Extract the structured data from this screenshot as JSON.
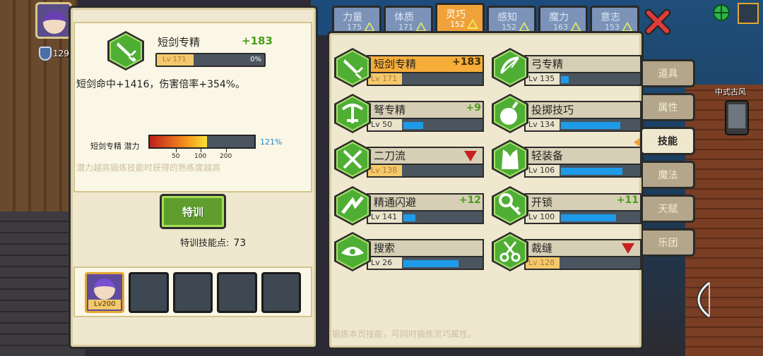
{
  "player": {
    "level": "129",
    "avatar_level": "Lv200"
  },
  "detail": {
    "name": "短剑专精",
    "bonus": "+183",
    "level": "Lv 171",
    "progress_percent": "0%",
    "description": "短剑命中+1416，伤害倍率+354%。",
    "potential_label": "短剑专精 潜力",
    "potential_value": "121%",
    "potential_fill": 0.55,
    "ticks": [
      "50",
      "100",
      "200"
    ],
    "potential_note": "潜力越高锻炼技能时获得的熟练度越高"
  },
  "training": {
    "button_label": "特训",
    "points_label": "特训技能点:",
    "points_value": "73"
  },
  "tabs": [
    {
      "name": "力量",
      "value": "175"
    },
    {
      "name": "体质",
      "value": "171"
    },
    {
      "name": "灵巧",
      "value": "152"
    },
    {
      "name": "感知",
      "value": "152"
    },
    {
      "name": "魔力",
      "value": "163"
    },
    {
      "name": "意志",
      "value": "153"
    }
  ],
  "skills": [
    {
      "name": "短剑专精",
      "bonus": "+183",
      "level": "Lv 171",
      "fill": 0.0,
      "icon": "dagger-icon"
    },
    {
      "name": "弓专精",
      "bonus": "",
      "level": "Lv 135",
      "fill": 0.1,
      "icon": "bow-icon"
    },
    {
      "name": "弩专精",
      "bonus": "+9",
      "level": "Lv 50",
      "fill": 0.25,
      "icon": "crossbow-icon"
    },
    {
      "name": "投掷技巧",
      "bonus": "",
      "level": "Lv 134",
      "fill": 0.75,
      "icon": "bomb-icon"
    },
    {
      "name": "二刀流",
      "bonus": "",
      "level": "Lv 138",
      "fill": 0.0,
      "icon": "dual-swords-icon"
    },
    {
      "name": "轻装备",
      "bonus": "",
      "level": "Lv 106",
      "fill": 0.78,
      "icon": "vest-icon"
    },
    {
      "name": "精通闪避",
      "bonus": "+12",
      "level": "Lv 141",
      "fill": 0.15,
      "icon": "dodge-icon"
    },
    {
      "name": "开锁",
      "bonus": "+11",
      "level": "Lv 100",
      "fill": 0.7,
      "icon": "key-icon"
    },
    {
      "name": "搜索",
      "bonus": "",
      "level": "Lv 26",
      "fill": 0.7,
      "icon": "search-eye-icon"
    },
    {
      "name": "裁缝",
      "bonus": "",
      "level": "Lv 128",
      "fill": 0.0,
      "icon": "scissors-icon"
    }
  ],
  "side_menu": [
    "道具",
    "属性",
    "技能",
    "魔法",
    "天赋",
    "乐团"
  ],
  "footnote": "锻炼本页技能，可同时锻炼灵巧属性。",
  "map_label": "中式古风"
}
